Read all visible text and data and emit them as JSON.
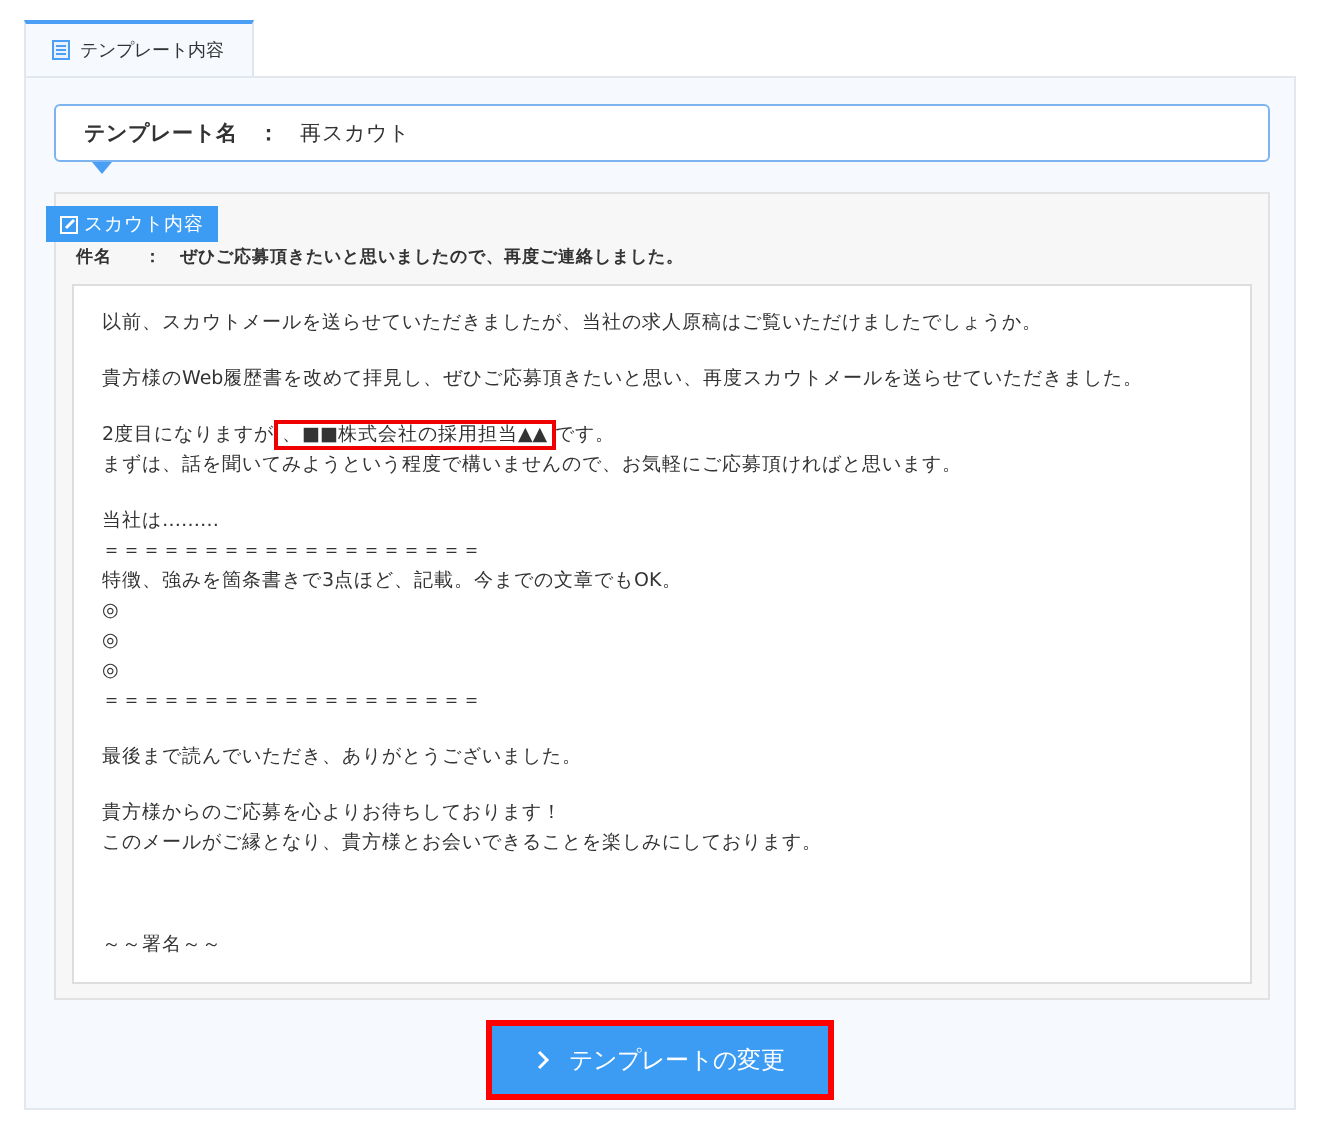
{
  "tabs": [
    {
      "label": "テンプレート内容",
      "selected": true
    }
  ],
  "template_name": {
    "label": "テンプレート名",
    "separator": "：",
    "value": "再スカウト"
  },
  "scout": {
    "badge": "スカウト内容",
    "subject_label": "件名",
    "subject_separator": "：",
    "subject": "ぜひご応募頂きたいと思いましたので、再度ご連絡しました。",
    "paragraphs": [
      {
        "kind": "text",
        "lines": [
          {
            "text": "以前、スカウトメールを送らせていただきましたが、当社の求人原稿はご覧いただけましたでしょうか。"
          }
        ]
      },
      {
        "kind": "text",
        "lines": [
          {
            "text": "貴方様のWeb履歴書を改めて拝見し、ぜひご応募頂きたいと思い、再度スカウトメールを送らせていただきました。"
          }
        ]
      },
      {
        "kind": "text",
        "lines": [
          {
            "kind": "highlight",
            "before": "2度目になりますが",
            "mark": "、■■株式会社の採用担当▲▲",
            "after": "です。"
          },
          {
            "text": "まずは、話を聞いてみようという程度で構いませんので、お気軽にご応募頂ければと思います。"
          }
        ]
      },
      {
        "kind": "text",
        "lines": [
          {
            "text": "当社は………"
          },
          {
            "text": "＝＝＝＝＝＝＝＝＝＝＝＝＝＝＝＝＝＝＝"
          },
          {
            "text": "特徴、強みを箇条書きで3点ほど、記載。今までの文章でもOK。"
          },
          {
            "text": "◎"
          },
          {
            "text": "◎"
          },
          {
            "text": "◎"
          },
          {
            "text": "＝＝＝＝＝＝＝＝＝＝＝＝＝＝＝＝＝＝＝"
          }
        ]
      },
      {
        "kind": "text",
        "lines": [
          {
            "text": "最後まで読んでいただき、ありがとうございました。"
          }
        ]
      },
      {
        "kind": "text",
        "lines": [
          {
            "text": "貴方様からのご応募を心よりお待ちしております！"
          },
          {
            "text": "このメールがご縁となり、貴方様とお会いできることを楽しみにしております。"
          }
        ]
      },
      {
        "kind": "signature",
        "lines": [
          {
            "text": "～～署名～～"
          }
        ]
      }
    ]
  },
  "button": {
    "label": "テンプレートの変更",
    "highlighted": true
  }
}
